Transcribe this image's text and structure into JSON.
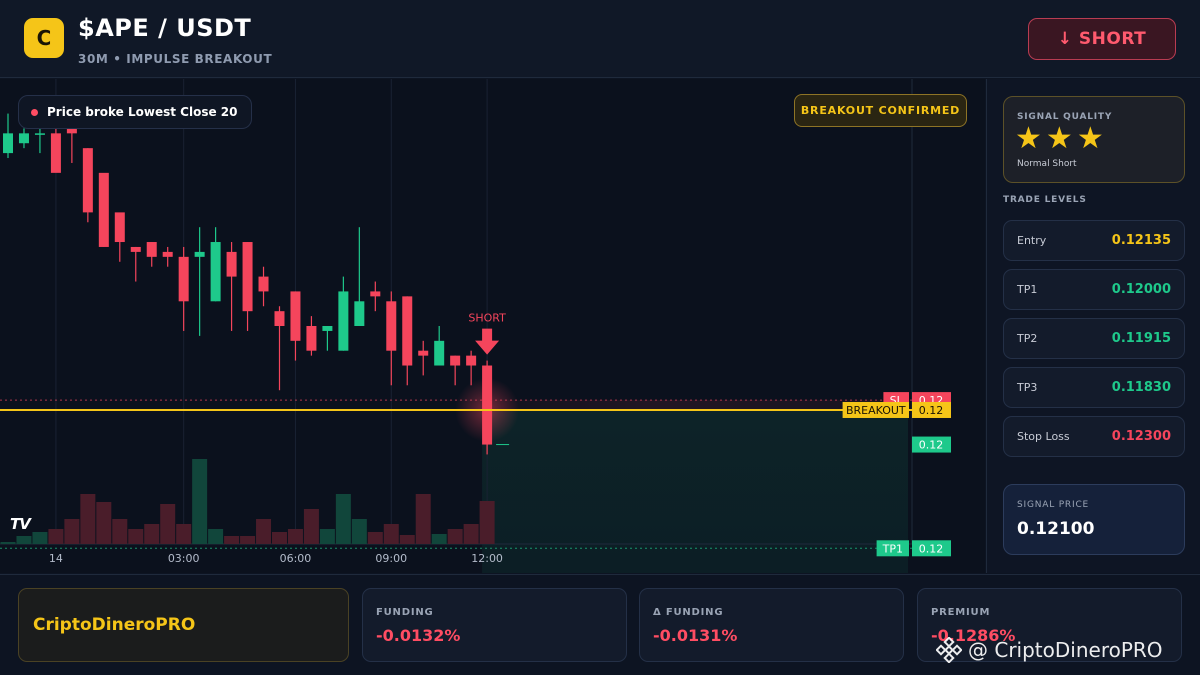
{
  "header": {
    "logo_letter": "C",
    "title": "$APE / USDT",
    "subtitle": "30M • IMPULSE BREAKOUT",
    "short_label": "↓ SHORT"
  },
  "chart": {
    "pill_text": "Price broke Lowest Close 20",
    "confirm_badge": "BREAKOUT CONFIRMED",
    "tv_logo": "TV",
    "short_marker": "SHORT",
    "time_labels": [
      "14",
      "03:00",
      "06:00",
      "09:00",
      "12:00"
    ],
    "price_tags": {
      "sl_label": "SL",
      "sl_value": "0.12",
      "breakout_label": "BREAKOUT",
      "breakout_value": "0.12",
      "last_value": "0.12",
      "tp1_label": "TP1",
      "tp1_value": "0.12"
    },
    "colors": {
      "up": "#1ec98b",
      "down": "#f5455c",
      "breakout": "#f5c518"
    }
  },
  "chart_data": {
    "type": "candlestick",
    "x": [
      "",
      "",
      "",
      "14",
      "",
      "",
      "",
      "",
      "",
      "",
      "",
      "03:00",
      "",
      "",
      "",
      "",
      "",
      "",
      "06:00",
      "",
      "",
      "",
      "",
      "",
      "09:00",
      "",
      "",
      "",
      "",
      "",
      "12:00"
    ],
    "series": [
      {
        "open": [
          0.128,
          0.1282,
          0.1284,
          0.1284,
          0.1285,
          0.1281,
          0.1276,
          0.1268,
          0.1261,
          0.1262,
          0.126,
          0.1259,
          0.1259,
          0.125,
          0.126,
          0.1262,
          0.1255,
          0.1248,
          0.1252,
          0.1245,
          0.1244,
          0.124,
          0.1245,
          0.1252,
          0.125,
          0.1251,
          0.124,
          0.1237,
          0.1239,
          0.1239,
          0.1237
        ],
        "close": [
          0.1284,
          0.1284,
          0.1284,
          0.1276,
          0.1284,
          0.1268,
          0.1261,
          0.1262,
          0.126,
          0.1259,
          0.1259,
          0.125,
          0.126,
          0.1262,
          0.1255,
          0.1248,
          0.1252,
          0.1245,
          0.1242,
          0.124,
          0.1245,
          0.1252,
          0.125,
          0.1251,
          0.124,
          0.1237,
          0.1239,
          0.1242,
          0.1237,
          0.1237,
          0.1221
        ],
        "high": [
          0.1288,
          0.1285,
          0.1286,
          0.1286,
          0.1286,
          0.1281,
          0.1271,
          0.1264,
          0.1261,
          0.1262,
          0.1261,
          0.1261,
          0.1265,
          0.1265,
          0.1262,
          0.1262,
          0.1257,
          0.1249,
          0.1252,
          0.1247,
          0.1245,
          0.1255,
          0.1265,
          0.1254,
          0.1252,
          0.1251,
          0.1242,
          0.1245,
          0.1239,
          0.124,
          0.1238
        ],
        "low": [
          0.1279,
          0.1281,
          0.128,
          0.1281,
          0.1278,
          0.1266,
          0.1261,
          0.1258,
          0.1254,
          0.1257,
          0.1257,
          0.1244,
          0.1243,
          0.125,
          0.1244,
          0.1244,
          0.1249,
          0.1232,
          0.1238,
          0.1239,
          0.124,
          0.124,
          0.1249,
          0.1248,
          0.1233,
          0.1233,
          0.1235,
          0.1238,
          0.1233,
          0.1233,
          0.1219
        ]
      }
    ],
    "volume": [
      0.2,
      0.8,
      1.2,
      1.5,
      2.5,
      5.0,
      4.2,
      2.5,
      1.5,
      2.0,
      4.0,
      2.0,
      8.5,
      1.5,
      0.8,
      0.8,
      2.5,
      1.2,
      1.5,
      3.5,
      1.5,
      5.0,
      2.5,
      1.2,
      2.0,
      0.9,
      5.0,
      1.0,
      1.5,
      2.0,
      4.3
    ],
    "levels": {
      "sl": 0.123,
      "breakout": 0.1228,
      "tp1": 0.12
    },
    "ylim": [
      0.1195,
      0.1295
    ],
    "grid": true
  },
  "signal_quality": {
    "title": "SIGNAL QUALITY",
    "stars": [
      "★",
      "★",
      "★"
    ],
    "subtitle": "Normal Short"
  },
  "trade_levels": {
    "title": "TRADE LEVELS",
    "items": [
      {
        "name": "Entry",
        "value": "0.12135",
        "color": "#f5c518"
      },
      {
        "name": "TP1",
        "value": "0.12000",
        "color": "#1ec98b"
      },
      {
        "name": "TP2",
        "value": "0.11915",
        "color": "#1ec98b"
      },
      {
        "name": "TP3",
        "value": "0.11830",
        "color": "#1ec98b"
      },
      {
        "name": "Stop Loss",
        "value": "0.12300",
        "color": "#f5455c"
      }
    ]
  },
  "signal_price": {
    "title": "SIGNAL PRICE",
    "value": "0.12100"
  },
  "footer": {
    "brand": "CriptoDineroPRO",
    "stats": [
      {
        "label": "FUNDING",
        "value": "-0.0132%"
      },
      {
        "label": "Δ FUNDING",
        "value": "-0.0131%"
      },
      {
        "label": "PREMIUM",
        "value": "-0.1286%"
      }
    ],
    "watermark": "@ CriptoDineroPRO"
  }
}
